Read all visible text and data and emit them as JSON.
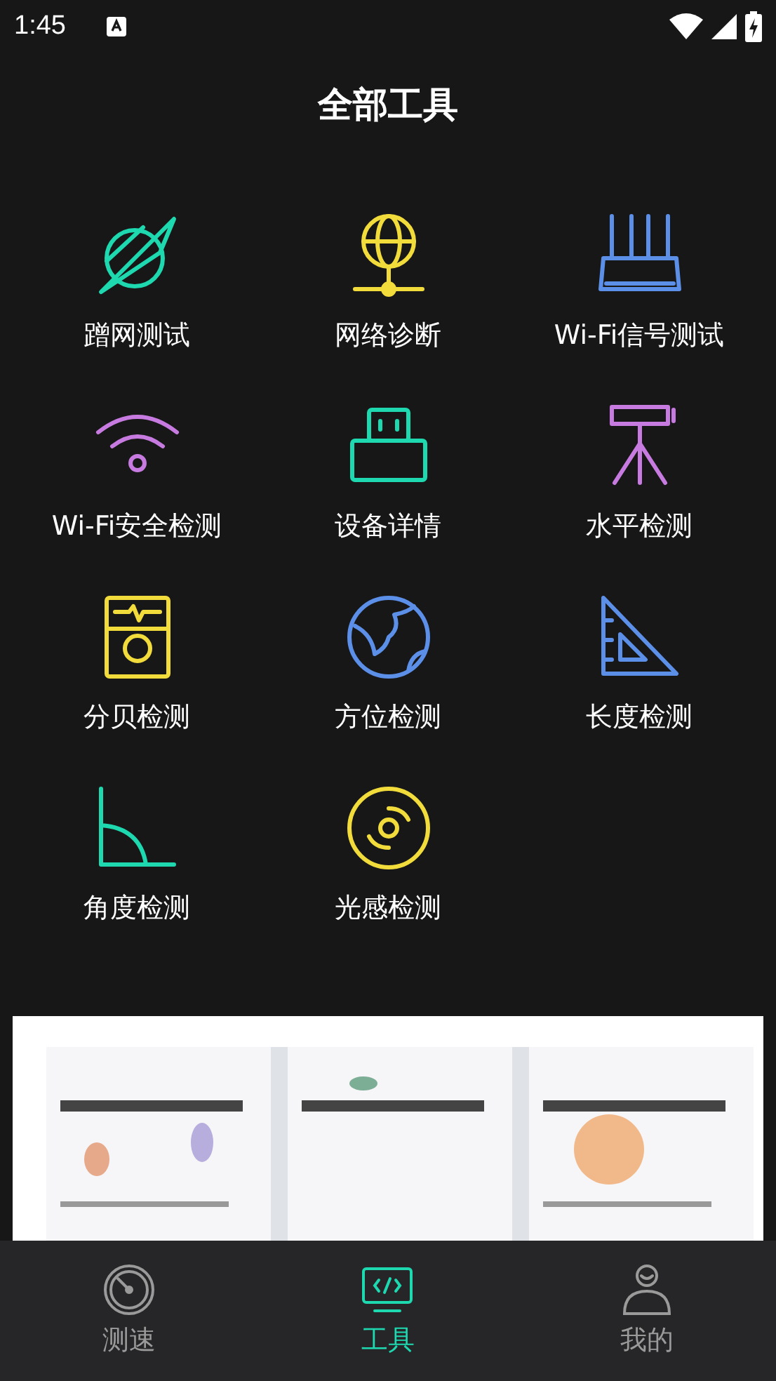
{
  "status_bar": {
    "time": "1:45"
  },
  "header": {
    "title": "全部工具"
  },
  "tools": [
    {
      "label": "蹭网测试",
      "color": "#1ed8b0"
    },
    {
      "label": "网络诊断",
      "color": "#f1dc3c"
    },
    {
      "label": "Wi-Fi信号测试",
      "color": "#5b8fe8"
    },
    {
      "label": "Wi-Fi安全检测",
      "color": "#c77be0"
    },
    {
      "label": "设备详情",
      "color": "#1ed8b0"
    },
    {
      "label": "水平检测",
      "color": "#c77be0"
    },
    {
      "label": "分贝检测",
      "color": "#f1dc3c"
    },
    {
      "label": "方位检测",
      "color": "#5b8fe8"
    },
    {
      "label": "长度检测",
      "color": "#5b8fe8"
    },
    {
      "label": "角度检测",
      "color": "#1ed8b0"
    },
    {
      "label": "光感检测",
      "color": "#f1dc3c"
    }
  ],
  "bottom_nav": [
    {
      "label": "测速",
      "selected": false
    },
    {
      "label": "工具",
      "selected": true
    },
    {
      "label": "我的",
      "selected": false
    }
  ]
}
